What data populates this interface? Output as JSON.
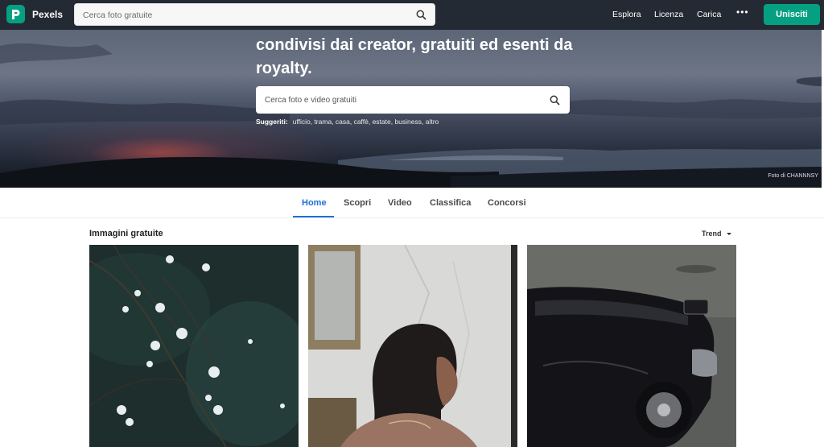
{
  "nav": {
    "brand": "Pexels",
    "search_placeholder": "Cerca foto gratuite",
    "links": [
      "Esplora",
      "Licenza",
      "Carica"
    ],
    "more": "•••",
    "join": "Unisciti"
  },
  "hero": {
    "title": "condivisi dai creator, gratuiti ed esenti da royalty.",
    "search_placeholder": "Cerca foto e video gratuiti",
    "suggest_label": "Suggeriti:",
    "suggestions": "ufficio, trama, casa, caffè, estate, business, altro",
    "credit": "Foto di CHANNNSY"
  },
  "tabs": [
    "Home",
    "Scopri",
    "Video",
    "Classifica",
    "Concorsi"
  ],
  "gallery": {
    "title": "Immagini gratuite",
    "sort": "Trend"
  },
  "colors": {
    "accent": "#05a081",
    "tab_active": "#1d6fdc",
    "nav_bg": "#232a34"
  }
}
